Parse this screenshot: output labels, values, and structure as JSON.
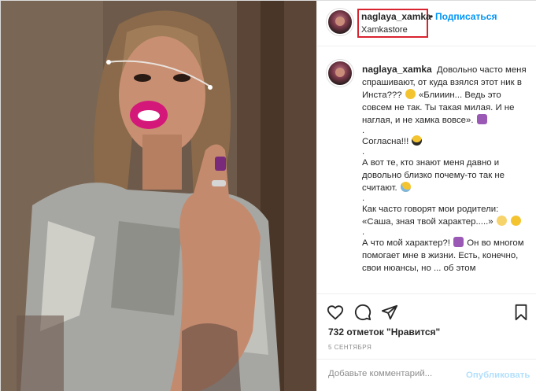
{
  "post": {
    "author": {
      "username": "naglaya_xamka",
      "location": "Xamkastore",
      "follow_label": "Подписаться",
      "separator": "•"
    },
    "caption": {
      "username": "naglaya_xamka",
      "paragraphs": [
        "Довольно часто меня спрашивают, от куда взялся этот ник в Инста???",
        "«Блииин... Ведь это совсем не так. Ты такая милая. И не наглая, и не хамка вовсе».",
        ".",
        "Согласна!!!",
        ".",
        "А вот те, кто знают меня давно и довольно близко почему-то так не считают.",
        ".",
        "Как часто говорят мои родители: «Саша, зная твой характер.....»",
        ".",
        "А что мой характер?!",
        "Он во многом помогает мне в жизни. Есть, конечно, свои нюансы, но ... об этом"
      ]
    },
    "likes_text": "732 отметок \"Нравится\"",
    "date_text": "5 СЕНТЯБРЯ",
    "add_comment_placeholder": "Добавьте комментарий...",
    "publish_label": "Опубликовать"
  },
  "icons": {
    "like": "heart-icon",
    "comment": "comment-icon",
    "share": "share-icon",
    "save": "bookmark-icon"
  },
  "colors": {
    "link_blue": "#0095f6",
    "publish_disabled": "#b2dffc",
    "highlight_red": "#d9232f"
  }
}
